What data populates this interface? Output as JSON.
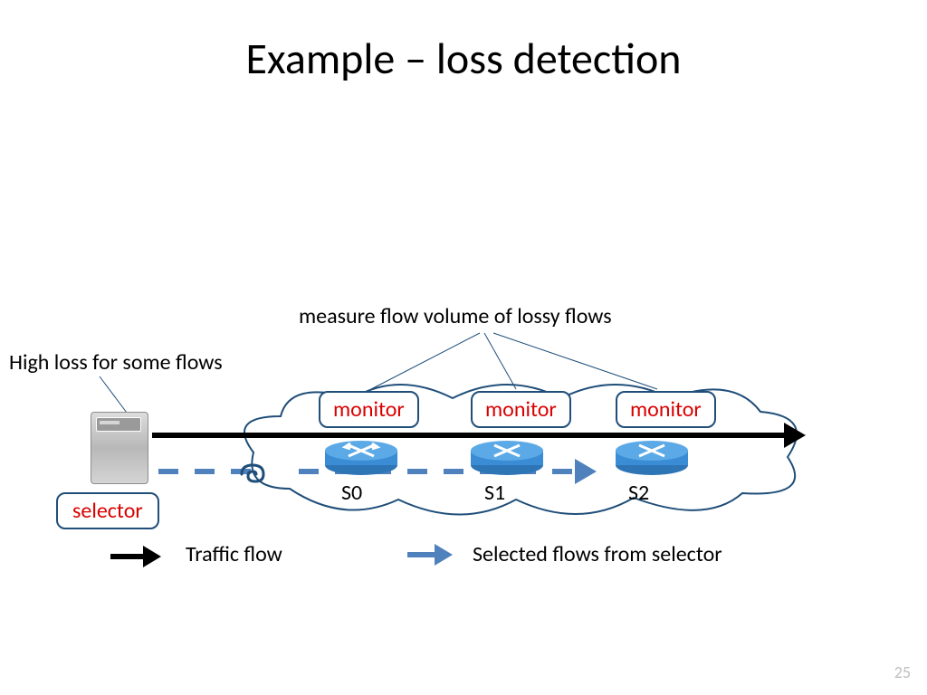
{
  "title": "Example – loss detection",
  "labels": {
    "high_loss": "High loss for some flows",
    "measure_flow": "measure flow volume of lossy flows",
    "selector": "selector",
    "monitor": "monitor",
    "legend_traffic": "Traffic flow",
    "legend_selected": "Selected flows from selector"
  },
  "routers": [
    {
      "name": "S0"
    },
    {
      "name": "S1"
    },
    {
      "name": "S2"
    }
  ],
  "page_number": "25"
}
